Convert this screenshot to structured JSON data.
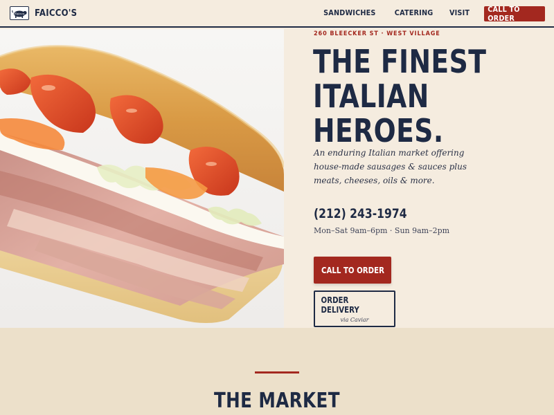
{
  "brand": {
    "name": "FAICCO'S",
    "logo_icon": "pig-logo-icon"
  },
  "nav": {
    "items": [
      {
        "label": "SANDWICHES"
      },
      {
        "label": "CATERING"
      },
      {
        "label": "VISIT"
      }
    ],
    "cta_label": "CALL TO ORDER"
  },
  "hero": {
    "kicker": "260 BLEECKER ST · WEST VILLAGE",
    "headline": [
      "THE FINEST",
      "ITALIAN",
      "HEROES."
    ],
    "tagline": "An enduring Italian market offering house-made sausages & sauces plus meats, cheeses, oils & more.",
    "phone": "(212) 243-1974",
    "hours": "Mon–Sat 9am–6pm · Sun 9am–2pm",
    "call_button": "CALL TO ORDER",
    "delivery_button": "ORDER DELIVERY",
    "delivery_sub": "via Caviar",
    "image_icon": "italian-hero-sandwich-photo"
  },
  "market": {
    "title": "THE MARKET"
  },
  "colors": {
    "background": "#f5ecdf",
    "navy": "#1e2a44",
    "accent_red": "#a3281f",
    "section_bg": "#ece0ca"
  }
}
